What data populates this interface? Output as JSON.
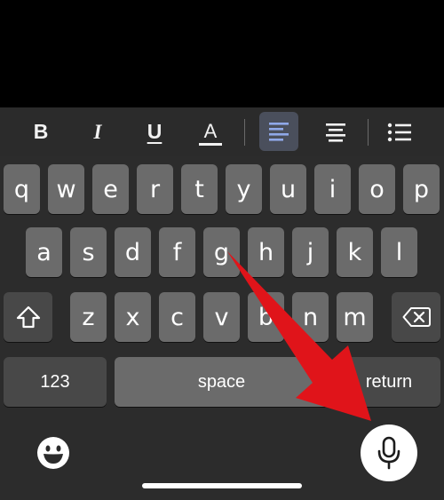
{
  "toolbar": {
    "bold": "B",
    "italic": "I",
    "underline": "U",
    "text_color": "A"
  },
  "keyboard": {
    "row1": [
      "q",
      "w",
      "e",
      "r",
      "t",
      "y",
      "u",
      "i",
      "o",
      "p"
    ],
    "row2": [
      "a",
      "s",
      "d",
      "f",
      "g",
      "h",
      "j",
      "k",
      "l"
    ],
    "row3": [
      "z",
      "x",
      "c",
      "v",
      "b",
      "n",
      "m"
    ],
    "numbers_label": "123",
    "space_label": "space",
    "return_label": "return"
  },
  "colors": {
    "key": "#6b6b6b",
    "function_key": "#484848",
    "keyboard_bg": "#2c2c2c",
    "toolbar_bg": "#2b2b2b",
    "arrow": "#e0141a"
  },
  "icons": {
    "shift": "shift-icon",
    "backspace": "backspace-icon",
    "emoji": "emoji-icon",
    "dictation": "microphone-icon",
    "align_left": "align-left-icon",
    "align_center": "align-center-icon",
    "list": "bullet-list-icon"
  }
}
